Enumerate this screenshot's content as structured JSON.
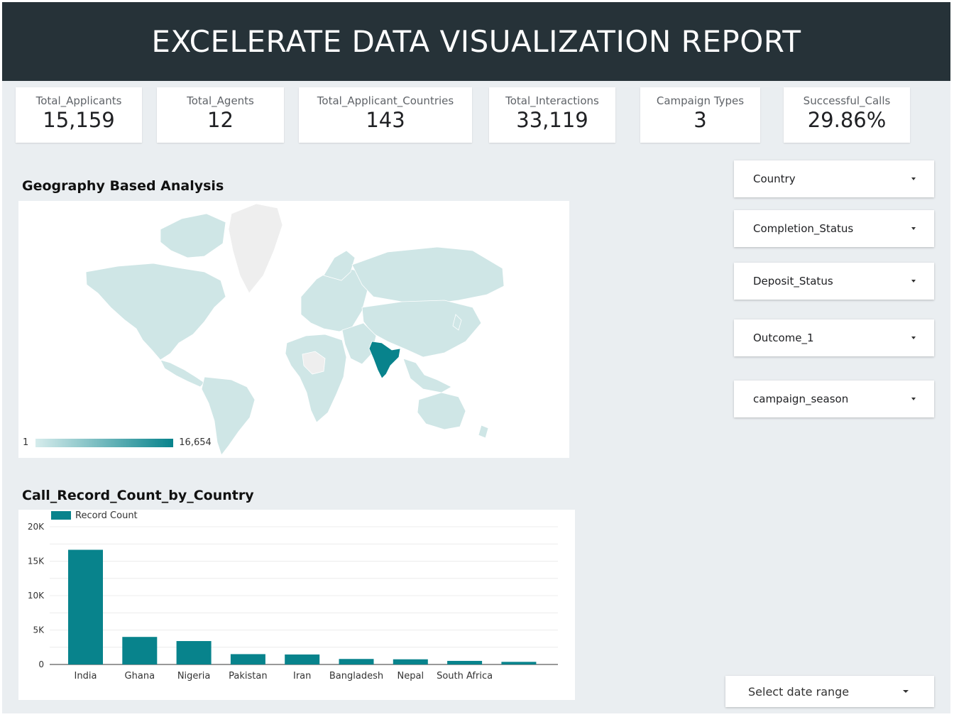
{
  "header": {
    "title": "EXCELERATE DATA VISUALIZATION REPORT"
  },
  "kpis": [
    {
      "label": "Total_Applicants",
      "value": "15,159"
    },
    {
      "label": "Total_Agents",
      "value": "12"
    },
    {
      "label": "Total_Applicant_Countries",
      "value": "143"
    },
    {
      "label": "Total_Interactions",
      "value": "33,119"
    },
    {
      "label": "Campaign Types",
      "value": "3"
    },
    {
      "label": "Successful_Calls",
      "value": "29.86%"
    }
  ],
  "geo": {
    "title": "Geography Based Analysis",
    "legend_min": "1",
    "legend_max": "16,654",
    "colors": {
      "low": "#d6ecec",
      "high": "#08838c",
      "nodata": "#eeeeee"
    },
    "highlight_country": "India"
  },
  "bar_section": {
    "title": "Call_Record_Count_by_Country"
  },
  "filters": [
    {
      "label": "Country"
    },
    {
      "label": "Completion_Status"
    },
    {
      "label": "Deposit_Status"
    },
    {
      "label": "Outcome_1"
    },
    {
      "label": "campaign_season"
    }
  ],
  "date_range": {
    "label": "Select date range"
  },
  "chart_data": {
    "type": "bar",
    "categories": [
      "India",
      "Ghana",
      "Nigeria",
      "Pakistan",
      "Iran",
      "Bangladesh",
      "Nepal",
      "South Africa",
      ""
    ],
    "series": [
      {
        "name": "Record Count",
        "values": [
          16654,
          4000,
          3400,
          1500,
          1450,
          800,
          750,
          520,
          380
        ],
        "color": "#08838c"
      }
    ],
    "ylim": [
      0,
      20000
    ],
    "yticks": [
      0,
      5000,
      10000,
      15000,
      20000
    ],
    "ytick_labels": [
      "0",
      "5K",
      "10K",
      "15K",
      "20K"
    ],
    "xlabel": "",
    "ylabel": "",
    "grid": true,
    "legend": "top-left"
  }
}
